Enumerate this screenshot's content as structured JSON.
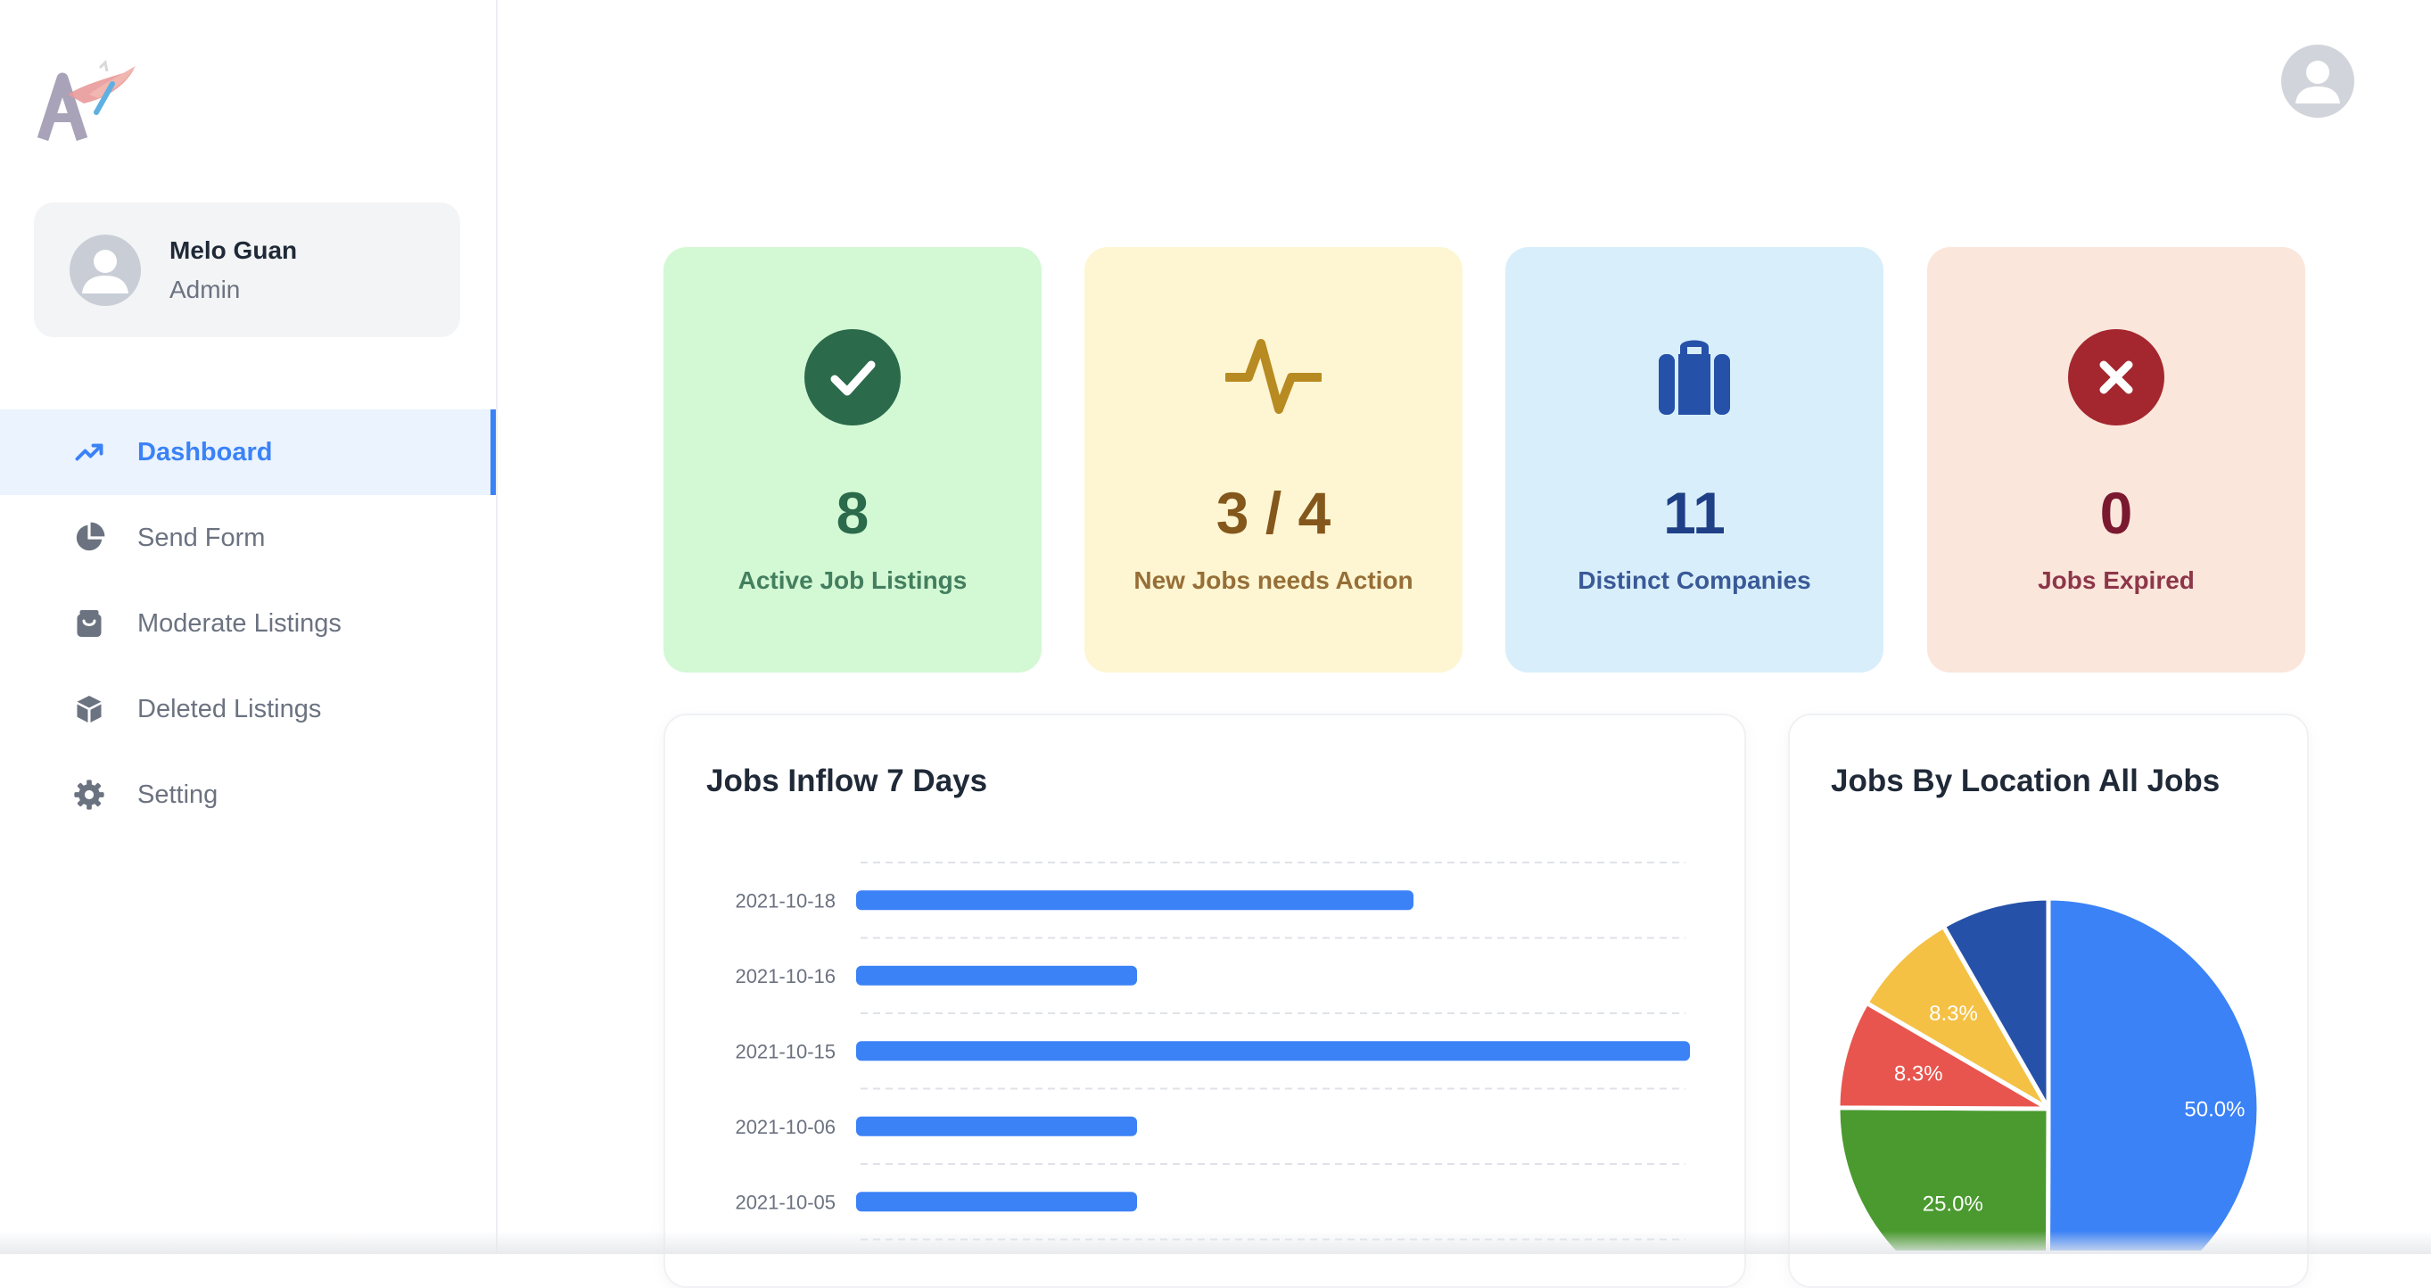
{
  "profile": {
    "name": "Melo Guan",
    "role": "Admin"
  },
  "nav": {
    "items": [
      {
        "label": "Dashboard",
        "icon": "trending-up-icon",
        "active": true
      },
      {
        "label": "Send Form",
        "icon": "pie-chart-icon",
        "active": false
      },
      {
        "label": "Moderate Listings",
        "icon": "shopping-bag-icon",
        "active": false
      },
      {
        "label": "Deleted Listings",
        "icon": "cube-icon",
        "active": false
      },
      {
        "label": "Setting",
        "icon": "gear-icon",
        "active": false
      }
    ]
  },
  "stats": [
    {
      "value": "8",
      "label": "Active Job Listings",
      "icon": "check-circle-icon",
      "bg": "#d3f8d4",
      "color": "#2b6a4b"
    },
    {
      "value": "3 / 4",
      "label": "New Jobs needs Action",
      "icon": "activity-icon",
      "bg": "#fef6d2",
      "color": "#84571c"
    },
    {
      "value": "11",
      "label": "Distinct Companies",
      "icon": "briefcase-icon",
      "bg": "#d8effb",
      "color": "#1f3f86"
    },
    {
      "value": "0",
      "label": "Jobs Expired",
      "icon": "x-circle-icon",
      "bg": "#fbe6db",
      "color": "#7a1830"
    }
  ],
  "colors": {
    "accent": "#3b82f6",
    "bar": "#3b82f6",
    "pie": [
      "#3b82f6",
      "#4a9a2f",
      "#e8554e",
      "#f4c145",
      "#2651a9"
    ]
  },
  "panels": {
    "inflow_title": "Jobs Inflow 7 Days",
    "location_title": "Jobs By Location All Jobs"
  },
  "chart_data": [
    {
      "type": "bar",
      "orientation": "horizontal",
      "title": "Jobs Inflow 7 Days",
      "categories": [
        "2021-10-18",
        "2021-10-16",
        "2021-10-15",
        "2021-10-06",
        "2021-10-05"
      ],
      "values": [
        2,
        1,
        3,
        1,
        1
      ],
      "xlim": [
        0,
        3
      ],
      "grid": true
    },
    {
      "type": "pie",
      "title": "Jobs By Location All Jobs",
      "values": [
        50.0,
        25.0,
        8.3,
        8.3,
        8.3
      ],
      "labels": [
        "50.0%",
        "25.0%",
        "8.3%",
        "8.3%",
        ""
      ]
    }
  ]
}
